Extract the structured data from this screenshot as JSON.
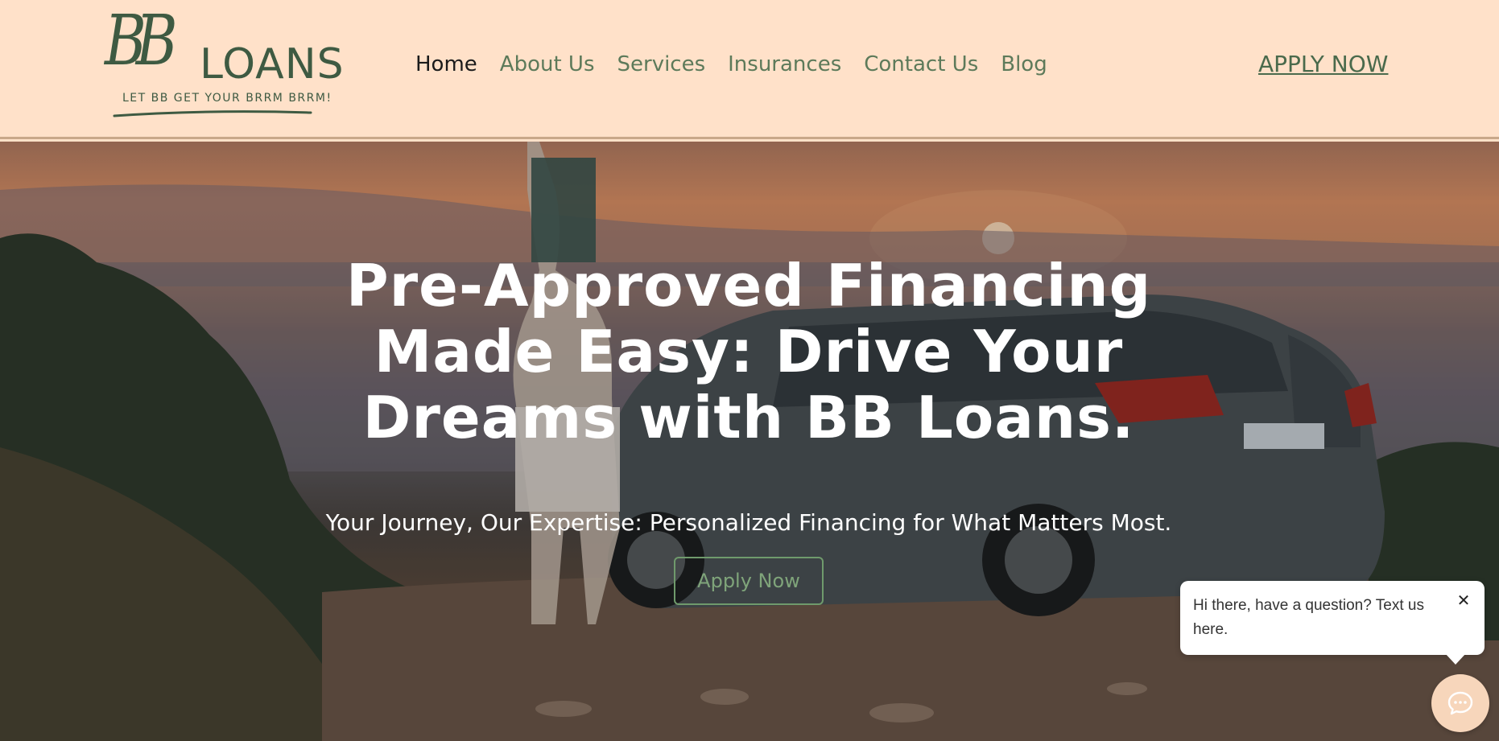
{
  "brand": {
    "logo_bb": "BB",
    "logo_loans": "LOANS",
    "tagline": "LET BB GET YOUR BRRM BRRM!",
    "colors": {
      "header_bg": "#ffe1c9",
      "brand_green": "#3e5a42",
      "nav_green": "#5d7a5a"
    }
  },
  "nav": {
    "items": [
      {
        "label": "Home",
        "active": true
      },
      {
        "label": "About Us",
        "active": false
      },
      {
        "label": "Services",
        "active": false
      },
      {
        "label": "Insurances",
        "active": false
      },
      {
        "label": "Contact Us",
        "active": false
      },
      {
        "label": "Blog",
        "active": false
      }
    ],
    "apply_label": "APPLY NOW"
  },
  "hero": {
    "title_lines": [
      "Pre-Approved Financing",
      "Made Easy: Drive Your",
      "Dreams with BB Loans."
    ],
    "subtitle": "Your Journey, Our Expertise: Personalized Financing for What Matters Most.",
    "button_label": "Apply Now",
    "image_description_icon": "sunset-car-photo"
  },
  "chat": {
    "message": "Hi there, have a question? Text us here.",
    "close_icon": "close-icon",
    "launcher_icon": "chat-icon"
  }
}
